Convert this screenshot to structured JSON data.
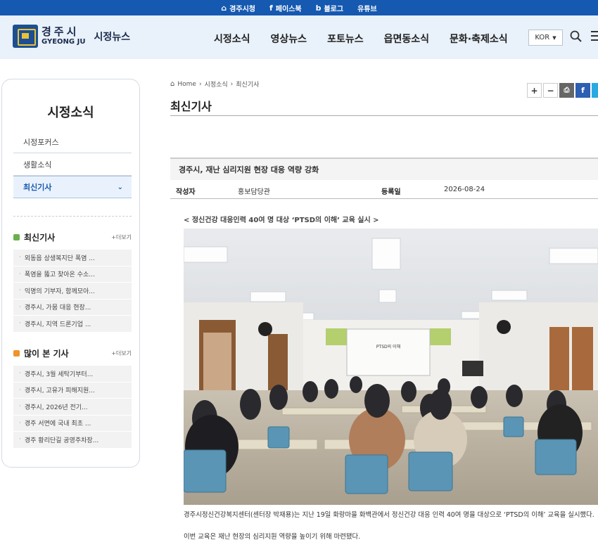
{
  "topbar": {
    "links": [
      {
        "icon": "home-icon",
        "label": "경주시청"
      },
      {
        "icon": "facebook-icon",
        "label": "페이스북"
      },
      {
        "icon": "blog-icon",
        "label": "블로그"
      },
      {
        "icon": "youtube-icon",
        "label": "유튜브"
      }
    ]
  },
  "header": {
    "logo_kr": "경주시",
    "logo_en": "GYEONG JU",
    "section": "시정뉴스",
    "nav": [
      "시정소식",
      "영상뉴스",
      "포토뉴스",
      "읍면동소식",
      "문화·축제소식"
    ],
    "lang": "KOR"
  },
  "sidebar": {
    "title": "시정소식",
    "menu": [
      "시정포커스",
      "생활소식",
      "최신기사"
    ],
    "latest_title": "최신기사",
    "latest_more": "+더보기",
    "latest": [
      "외동읍 상생복지단 폭염 ...",
      "폭염을 뚫고 찾아온 수소...",
      "익명의 기부자, 함께모아...",
      "경주시, 가뭄 대응 현장...",
      "경주시, 지역 드론기업 ..."
    ],
    "popular_title": "많이 본 기사",
    "popular_more": "+더보기",
    "popular": [
      "경주시, 3월 세탁기부터...",
      "경주시, 고유가 피해지원...",
      "경주시, 2026년 전기...",
      "경주 서면에 국내 최초 ...",
      "경주 황리단길 공영주차장..."
    ]
  },
  "breadcrumb": {
    "home": "Home",
    "level1": "시정소식",
    "level2": "최신기사"
  },
  "page_title": "최신기사",
  "article": {
    "title": "경주시, 재난 심리지원 현장 대응 역량 강화",
    "author_label": "작성자",
    "author": "홍보담당관",
    "date_label": "등록일",
    "date": "2026-08-24",
    "subhead": "< 정신건강 대응인력 40여 명 대상 ‘PTSD의 이해’ 교육 실시 >",
    "screen_text": "PTSD의 이해",
    "paragraph1": "경주시정신건강복지센터(센터장 박재용)는 지난 19일 화랑마을 화백관에서 정신건강 대응 인력 40여 명을 대상으로 ‘PTSD의 이해’ 교육을 실시했다.",
    "paragraph2": "이번 교육은 재난 현장의 심리지원 역량을 높이기 위해 마련됐다."
  },
  "colors": {
    "topbar": "#1659b0",
    "header_bg": "#e9f1fa",
    "active_menu": "#1659b0",
    "green_square": "#6ab04c",
    "orange_square": "#f0932b"
  }
}
